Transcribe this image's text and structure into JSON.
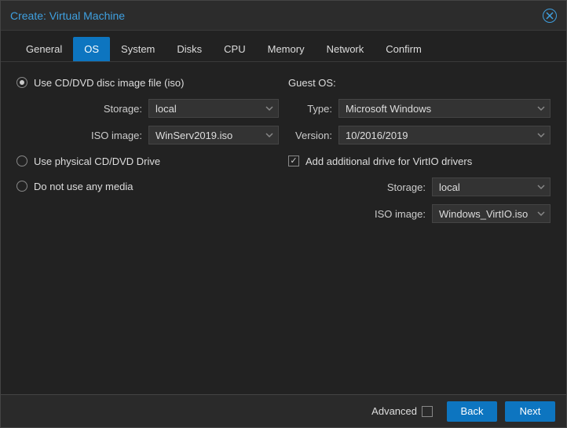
{
  "title": "Create: Virtual Machine",
  "tabs": [
    "General",
    "OS",
    "System",
    "Disks",
    "CPU",
    "Memory",
    "Network",
    "Confirm"
  ],
  "active_tab": 1,
  "left": {
    "radio_iso": "Use CD/DVD disc image file (iso)",
    "radio_physical": "Use physical CD/DVD Drive",
    "radio_none": "Do not use any media",
    "storage_label": "Storage:",
    "storage_value": "local",
    "iso_label": "ISO image:",
    "iso_value": "WinServ2019.iso"
  },
  "right": {
    "guest_os_label": "Guest OS:",
    "type_label": "Type:",
    "type_value": "Microsoft Windows",
    "version_label": "Version:",
    "version_value": "10/2016/2019",
    "virtio_check": "Add additional drive for VirtIO drivers",
    "virtio_storage_label": "Storage:",
    "virtio_storage_value": "local",
    "virtio_iso_label": "ISO image:",
    "virtio_iso_value": "Windows_VirtIO.iso"
  },
  "footer": {
    "advanced": "Advanced",
    "back": "Back",
    "next": "Next"
  }
}
